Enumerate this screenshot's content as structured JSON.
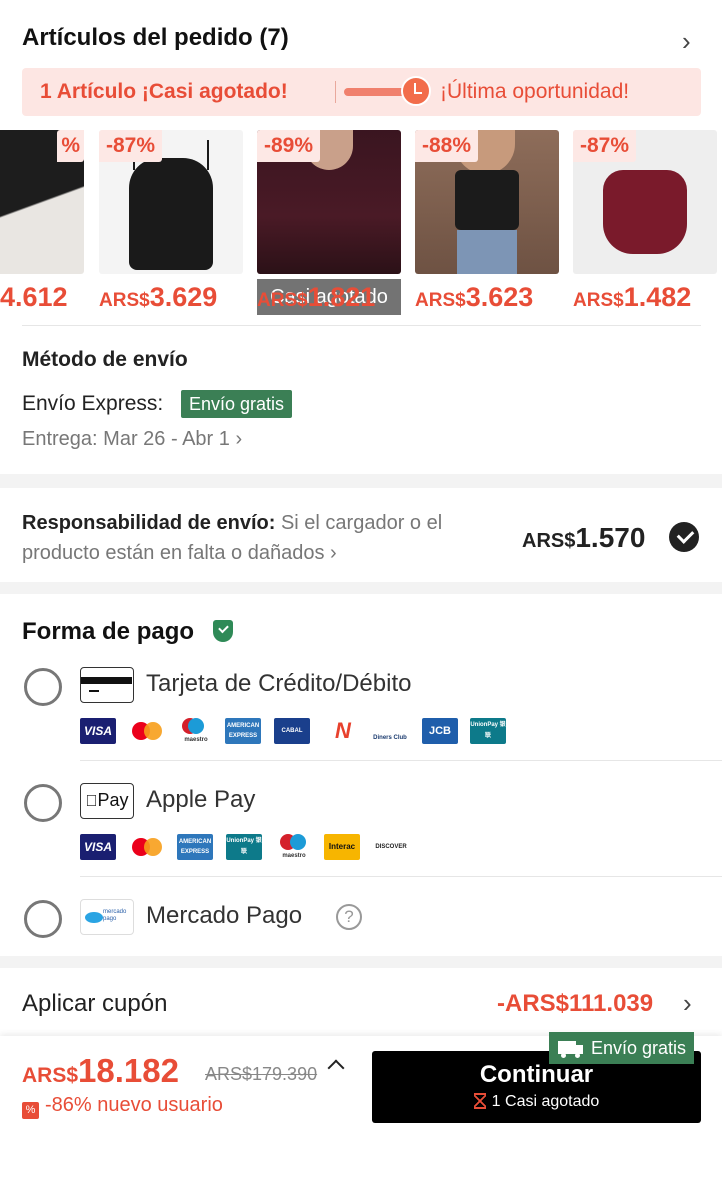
{
  "order": {
    "title": "Artículos del pedido (7)",
    "banner": {
      "left_text": "1 Artículo ¡Casi agotado!",
      "right_text": "¡Última oportunidad!"
    },
    "products": [
      {
        "discount": "%",
        "currency": "",
        "amount": "4.612",
        "soldout": "",
        "colors": [
          "#1d1d1d",
          "#e9e6e2"
        ]
      },
      {
        "discount": "-87%",
        "currency": "ARS$",
        "amount": "3.629",
        "soldout": "",
        "colors": [
          "#1a1a1a",
          "#f4f4f4"
        ]
      },
      {
        "discount": "-89%",
        "currency": "ARS$",
        "amount": "1.821",
        "soldout": "Casi agotado",
        "colors": [
          "#4a1a26",
          "#2b1117"
        ]
      },
      {
        "discount": "-88%",
        "currency": "ARS$",
        "amount": "3.623",
        "soldout": "",
        "colors": [
          "#1b1b1b",
          "#8e6d5a"
        ]
      },
      {
        "discount": "-87%",
        "currency": "ARS$",
        "amount": "1.482",
        "soldout": "",
        "colors": [
          "#7a1a2b",
          "#eeeeee"
        ]
      }
    ]
  },
  "shipping": {
    "title": "Método de envío",
    "method": "Envío Express:",
    "badge": "Envío gratis",
    "eta": "Entrega: Mar 26 - Abr 1"
  },
  "responsibility": {
    "label": "Responsabilidad de envío:",
    "description": "Si el cargador o el producto están en falta o dañados",
    "currency": "ARS$",
    "amount": "1.570"
  },
  "payment": {
    "title": "Forma de pago",
    "options": [
      {
        "label": "Tarjeta de Crédito/Débito"
      },
      {
        "label": "Apple Pay",
        "icon_text": "Pay"
      },
      {
        "label": "Mercado Pago",
        "icon_text": "mercado pago"
      }
    ],
    "card_logos": [
      {
        "name": "VISA",
        "color": "#1a1f71"
      },
      {
        "name": "",
        "color": "#ffffff"
      },
      {
        "name": "maestro",
        "color": "#ffffff"
      },
      {
        "name": "AMERICAN EXPRESS",
        "color": "#2e77bb"
      },
      {
        "name": "CABAL",
        "color": "#1a3f8c"
      },
      {
        "name": "N",
        "color": "#ffffff"
      },
      {
        "name": "Diners Club",
        "color": "#ffffff"
      },
      {
        "name": "JCB",
        "color": "#1f5eab"
      },
      {
        "name": "UnionPay 银联",
        "color": "#0d7a8a"
      }
    ],
    "applepay_logos": [
      {
        "name": "VISA",
        "color": "#1a1f71"
      },
      {
        "name": "",
        "color": "#ffffff"
      },
      {
        "name": "AMERICAN EXPRESS",
        "color": "#2e77bb"
      },
      {
        "name": "UnionPay 银联",
        "color": "#0d7a8a"
      },
      {
        "name": "maestro",
        "color": "#ffffff"
      },
      {
        "name": "Interac",
        "color": "#f7b500"
      },
      {
        "name": "DISCOVER",
        "color": "#ffffff"
      }
    ]
  },
  "coupon": {
    "label": "Aplicar cupón",
    "value": "-ARS$111.039"
  },
  "footer": {
    "currency": "ARS$",
    "total": "18.182",
    "old_total": "ARS$179.390",
    "discount_text": "-86% nuevo usuario",
    "free_shipping": "Envío gratis",
    "cta_label": "Continuar",
    "cta_sub": "1 Casi agotado"
  },
  "colors": {
    "accent": "#e84d37",
    "green": "#3b7f55",
    "cta": "#000000"
  }
}
